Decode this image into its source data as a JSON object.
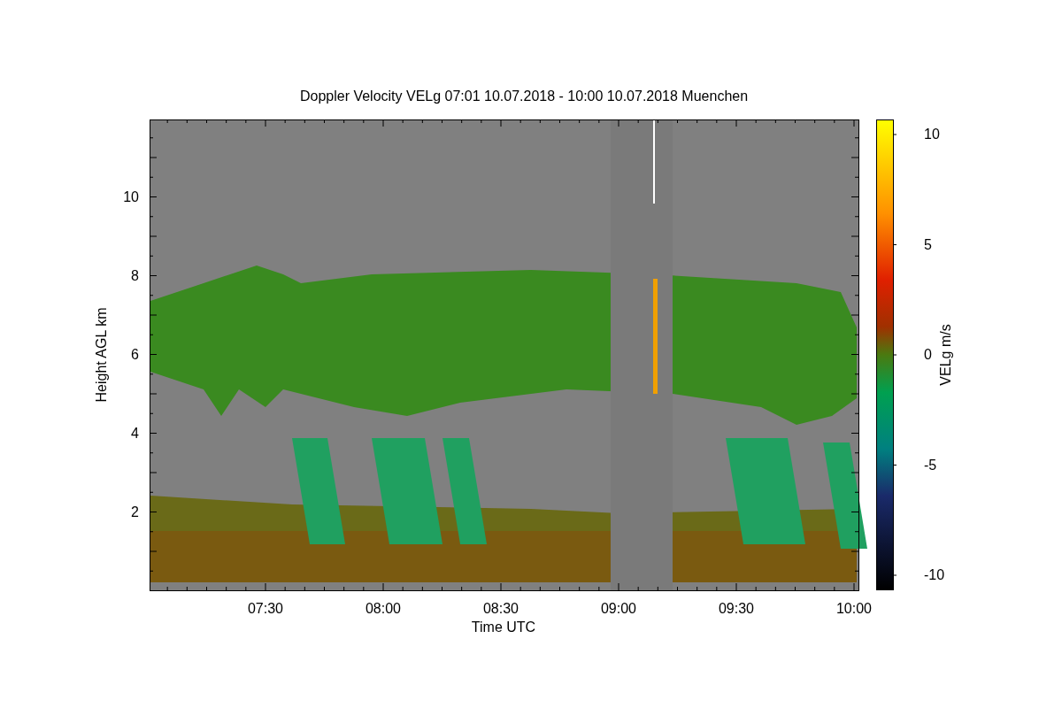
{
  "chart": {
    "title": "Doppler Velocity VELg   07:01 10.07.2018 - 10:00 10.07.2018 Muenchen",
    "ylabel": "Height AGL km",
    "xlabel": "Time UTC",
    "yticks": [
      "10",
      "8",
      "6",
      "4",
      "2"
    ],
    "xticks": [
      "07:30",
      "08:00",
      "08:30",
      "09:00",
      "09:30",
      "10:00"
    ],
    "colorbar": {
      "label": "VELg m/s",
      "ticks": [
        "10",
        "5",
        "0",
        "-5",
        "-10"
      ]
    }
  }
}
